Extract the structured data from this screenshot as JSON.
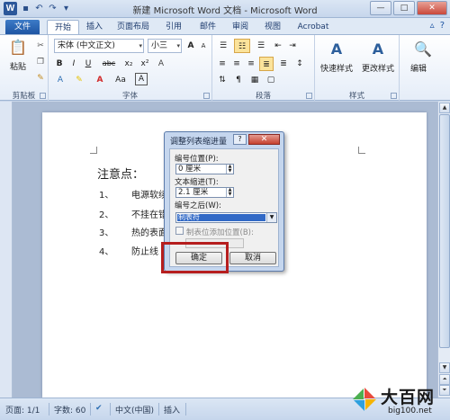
{
  "window": {
    "title": "新建 Microsoft Word 文档 - Microsoft Word",
    "logo": "W",
    "controls": [
      "—",
      "□",
      "✕"
    ]
  },
  "tabs": [
    "文件",
    "开始",
    "插入",
    "页面布局",
    "引用",
    "邮件",
    "审阅",
    "视图",
    "Acrobat"
  ],
  "ribbon": {
    "clipboard": {
      "paste_label": "粘贴",
      "group_label": "剪贴板"
    },
    "font": {
      "font_name": "宋体 (中文正文)",
      "font_size": "小三",
      "group_label": "字体",
      "buttons": [
        "B",
        "I",
        "U",
        "abc",
        "x₂",
        "x²",
        "A",
        "Aa",
        "A",
        "A"
      ]
    },
    "paragraph": {
      "group_label": "段落"
    },
    "styles": {
      "quick_styles_label": "快速样式",
      "change_styles_label": "更改样式",
      "group_label": "样式"
    },
    "editing": {
      "label": "编辑"
    }
  },
  "document": {
    "heading": "注意点：",
    "items": [
      {
        "num": "1、",
        "text": "电源软续"
      },
      {
        "num": "2、",
        "text": "不挂在错"
      },
      {
        "num": "3、",
        "text": "热的表面"
      },
      {
        "num": "4、",
        "text": "防止线"
      }
    ]
  },
  "dialog": {
    "title": "调整列表缩进量",
    "help": "?",
    "close": "✕",
    "position_label": "编号位置(P):",
    "position_value": "0 厘米",
    "indent_label": "文本缩进(T):",
    "indent_value": "2.1 厘米",
    "after_label": "编号之后(W):",
    "after_value": "制表符",
    "checkbox_label": "制表位添加位置(B):",
    "ok": "确定",
    "cancel": "取消"
  },
  "statusbar": {
    "page": "页面: 1/1",
    "words": "字数: 60",
    "language": "中文(中国)",
    "mode": "插入"
  },
  "watermark": {
    "brand": "大百网",
    "url": "big100.net"
  },
  "colors": {
    "file_tab": "#1e55a3",
    "selection": "#3169c6",
    "highlight_box": "#b61e1e"
  }
}
